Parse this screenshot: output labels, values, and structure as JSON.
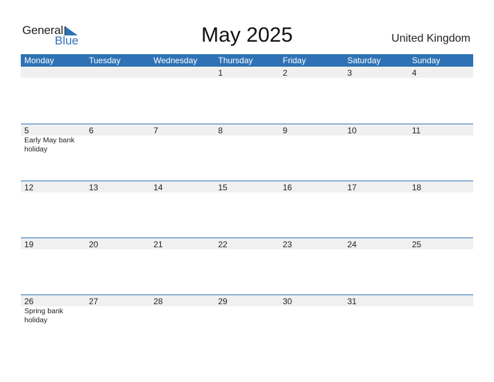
{
  "logo": {
    "part1": "General",
    "part2": "Blue"
  },
  "title": "May 2025",
  "country": "United Kingdom",
  "colors": {
    "accent": "#2e72b5",
    "strip": "#f0f0f0"
  },
  "weekdays": [
    "Monday",
    "Tuesday",
    "Wednesday",
    "Thursday",
    "Friday",
    "Saturday",
    "Sunday"
  ],
  "weeks": [
    {
      "days": [
        {
          "d": "",
          "h": ""
        },
        {
          "d": "",
          "h": ""
        },
        {
          "d": "",
          "h": ""
        },
        {
          "d": "1",
          "h": ""
        },
        {
          "d": "2",
          "h": ""
        },
        {
          "d": "3",
          "h": ""
        },
        {
          "d": "4",
          "h": ""
        }
      ]
    },
    {
      "days": [
        {
          "d": "5",
          "h": "Early May bank holiday"
        },
        {
          "d": "6",
          "h": ""
        },
        {
          "d": "7",
          "h": ""
        },
        {
          "d": "8",
          "h": ""
        },
        {
          "d": "9",
          "h": ""
        },
        {
          "d": "10",
          "h": ""
        },
        {
          "d": "11",
          "h": ""
        }
      ]
    },
    {
      "days": [
        {
          "d": "12",
          "h": ""
        },
        {
          "d": "13",
          "h": ""
        },
        {
          "d": "14",
          "h": ""
        },
        {
          "d": "15",
          "h": ""
        },
        {
          "d": "16",
          "h": ""
        },
        {
          "d": "17",
          "h": ""
        },
        {
          "d": "18",
          "h": ""
        }
      ]
    },
    {
      "days": [
        {
          "d": "19",
          "h": ""
        },
        {
          "d": "20",
          "h": ""
        },
        {
          "d": "21",
          "h": ""
        },
        {
          "d": "22",
          "h": ""
        },
        {
          "d": "23",
          "h": ""
        },
        {
          "d": "24",
          "h": ""
        },
        {
          "d": "25",
          "h": ""
        }
      ]
    },
    {
      "days": [
        {
          "d": "26",
          "h": "Spring bank holiday"
        },
        {
          "d": "27",
          "h": ""
        },
        {
          "d": "28",
          "h": ""
        },
        {
          "d": "29",
          "h": ""
        },
        {
          "d": "30",
          "h": ""
        },
        {
          "d": "31",
          "h": ""
        },
        {
          "d": "",
          "h": ""
        }
      ]
    }
  ]
}
